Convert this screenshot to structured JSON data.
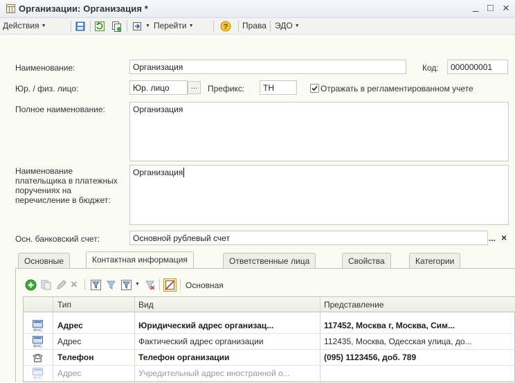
{
  "window": {
    "title": "Организации: Организация *",
    "controls": {
      "minimize": "_",
      "maximize": "□",
      "close": "×"
    }
  },
  "toolbar": {
    "actions": "Действия",
    "goto": "Перейти",
    "rights": "Права",
    "edo": "ЭДО"
  },
  "form": {
    "name_label": "Наименование:",
    "name_value": "Организация",
    "code_label": "Код:",
    "code_value": "000000001",
    "legal_label": "Юр. / физ. лицо:",
    "legal_value": "Юр. лицо",
    "prefix_label": "Префикс:",
    "prefix_value": "ТН",
    "reflect_label": "Отражать в регламентированном учете",
    "reflect_checked": true,
    "full_name_label": "Полное наименование:",
    "full_name_value": "Организация",
    "payer_label": "Наименование плательщика в платежных поручениях на перечисление в бюджет:",
    "payer_value": "Организация",
    "bank_label": "Осн. банковский счет:",
    "bank_value": "Основной рублевый счет"
  },
  "tabs": [
    {
      "label": "Основные"
    },
    {
      "label": "Контактная информация",
      "active": true
    },
    {
      "label": "Ответственные лица"
    },
    {
      "label": "Свойства"
    },
    {
      "label": "Категории"
    }
  ],
  "grid_toolbar": {
    "main_label": "Основная"
  },
  "grid": {
    "columns": [
      "Тип",
      "Вид",
      "Представление"
    ],
    "rows": [
      {
        "icon": "fns-address-icon",
        "type": "Адрес",
        "kind": "Юридический адрес организац...",
        "value": "117452, Москва г, Москва, Сим...",
        "style": "bold"
      },
      {
        "icon": "fns-address-icon",
        "type": "Адрес",
        "kind": "Фактический адрес организации",
        "value": "112435, Москва, Одесская улица, до...",
        "style": "normal"
      },
      {
        "icon": "phone-icon",
        "type": "Телефон",
        "kind": "Телефон организации",
        "value": "(095) 1123456, доб. 789",
        "style": "bold"
      },
      {
        "icon": "fns-address-icon",
        "type": "Адрес",
        "kind": "Учредительный адрес иностранной о...",
        "value": "",
        "style": "dim"
      }
    ]
  },
  "colors": {
    "accent_green": "#3aa93a",
    "window_bg": "#fbfbf6",
    "header_bg": "#ecede5"
  }
}
